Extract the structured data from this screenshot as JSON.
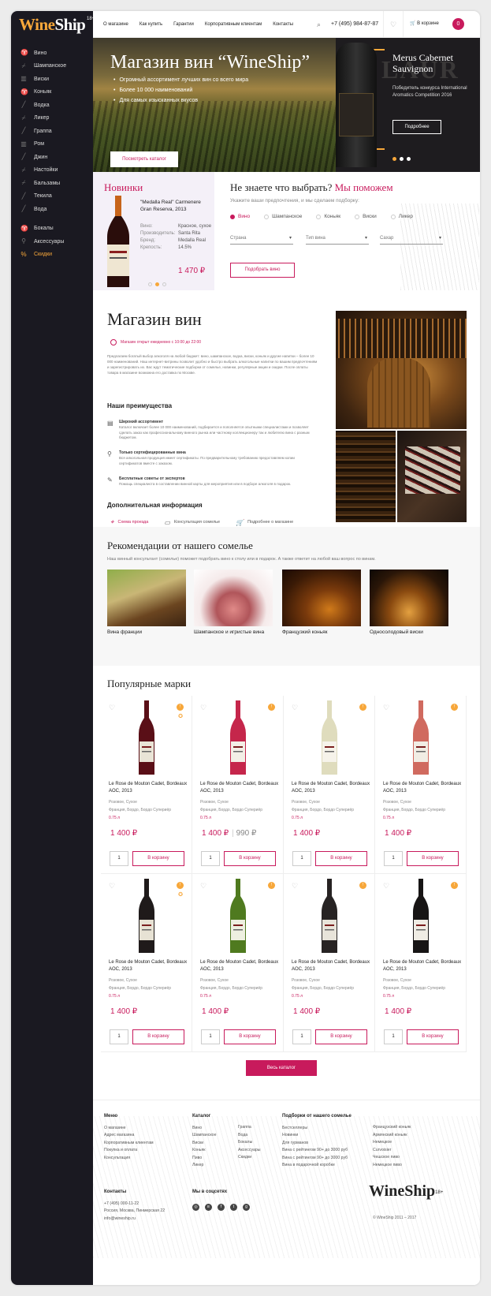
{
  "logo": {
    "part1": "Wine",
    "part2": "Ship",
    "age": "18+"
  },
  "sidebar": {
    "items": [
      {
        "label": "Вино",
        "icon": "wine-glass-icon"
      },
      {
        "label": "Шампанское",
        "icon": "champagne-icon"
      },
      {
        "label": "Виски",
        "icon": "whisky-icon"
      },
      {
        "label": "Коньяк",
        "icon": "cognac-icon"
      },
      {
        "label": "Водка",
        "icon": "vodka-icon"
      },
      {
        "label": "Ликер",
        "icon": "liqueur-icon"
      },
      {
        "label": "Граппа",
        "icon": "grappa-icon"
      },
      {
        "label": "Ром",
        "icon": "rum-icon"
      },
      {
        "label": "Джин",
        "icon": "gin-icon"
      },
      {
        "label": "Настойки",
        "icon": "tincture-icon"
      },
      {
        "label": "Бальзамы",
        "icon": "balsam-icon"
      },
      {
        "label": "Текила",
        "icon": "tequila-icon"
      },
      {
        "label": "Вода",
        "icon": "water-icon"
      }
    ],
    "extra": [
      {
        "label": "Бокалы",
        "icon": "glass-icon"
      },
      {
        "label": "Аксессуары",
        "icon": "accessory-icon"
      },
      {
        "label": "Скидки",
        "icon": "percent-icon"
      }
    ]
  },
  "header": {
    "nav": [
      "О магазине",
      "Как купить",
      "Гарантии",
      "Корпоративным клиентам",
      "Контакты"
    ],
    "phone": "+7 (495) 984-87-87",
    "cart_label": "В корзине",
    "cart_count": "0"
  },
  "hero": {
    "title": "Магазин вин “WineShip”",
    "bullets": [
      "Огромный ассортимент лучших вин со всего мира",
      "Более 10 000 наименований",
      "Для самых изысканных вкусов"
    ],
    "button": "Посмотреть каталог"
  },
  "promo": {
    "glyph": "LAUR",
    "title": "Merus Cabernet Sauvignon",
    "desc": "Победитель конкурса International Aromatics Competition 2016",
    "button": "Подробнее"
  },
  "news": {
    "title": "Новинки",
    "product": "\"Medalla Real\" Carmenere Gran Reserva, 2013",
    "specs": [
      {
        "k": "Вино:",
        "v": "Красное, сухое"
      },
      {
        "k": "Производитель:",
        "v": "Santa Rita"
      },
      {
        "k": "Бренд:",
        "v": "Medalla Real"
      },
      {
        "k": "Крепость:",
        "v": "14.5%"
      }
    ],
    "price": "1 470 ₽"
  },
  "helper": {
    "title": "Не знаете что выбрать?",
    "title_hl": "Мы поможем",
    "sub": "Укажите ваши предпочтения, и мы сделаем подборку:",
    "radios": [
      "Вино",
      "Шампанское",
      "Коньяк",
      "Виски",
      "Ликер"
    ],
    "selects": [
      "Страна",
      "Тип вина",
      "Сахар"
    ],
    "button": "Подобрать вино"
  },
  "store": {
    "title": "Магазин вин",
    "hours": "Магазин открыт ежедневно с 10:00 до 22:00",
    "intro": "Предлагаем богатый выбор алкоголя на любой бюджет: вино, шампанское, водка, виски, коньяк и другие напитки – более 10 000 наименований. Наш интернет-витрины позволит удобно и быстро выбрать алкогольные напитки по вашим предпочтениям и зарегистрировать их. Вас ждут тематические подборки от сомелье, новинки, регулярные акции и скидки. После оплаты товара в магазине возможна его доставка по Москве.",
    "adv_title": "Наши преимущества",
    "adv": [
      {
        "t": "Широкий ассортимент",
        "d": "Каталог включает более 10 000 наименований, подбирается и пополняется опытными специалистами и позволяет сделать заказ как профессиональному винного рынка или частному коллекционеру так и любителю вина с разным бюджетом."
      },
      {
        "t": "Только сертифицированные вина",
        "d": "Вся алкогольная продукция имеет сертификаты. По предварительному требованию предоставляем копии сертификатов вместе с заказом."
      },
      {
        "t": "Бесплатные советы от экспертов",
        "d": "Помощь специалиста в составлении винной карты для мероприятия или в подборе алкоголя в подарок."
      }
    ],
    "info_title": "Дополнительная информация",
    "info": [
      "Схема проезда",
      "Консультация сомелье",
      "Подробнее о магазине"
    ]
  },
  "somm": {
    "title": "Рекомендации от нашего сомелье",
    "desc": "Наш винный консультант (сомелье) поможет подобрать вино к столу или в подарок. А также ответит на любой ваш вопрос по винам.",
    "cards": [
      "Вина франции",
      "Шампанское и игристые вина",
      "Французкий коньяк",
      "Односолодовый виски"
    ]
  },
  "brands": {
    "title": "Популярные марки",
    "products": [
      {
        "name": "Le Rose de Mouton Cadet, Bordeaux AOC, 2013",
        "type": "Розовое, Сухое",
        "region": "Франция, Бордо, Бордо Супериёр",
        "vol": "0.75 л",
        "price": "1 400 ₽",
        "old": "",
        "color": "#5a0f17",
        "label": "#e9e4d6"
      },
      {
        "name": "Le Rose de Mouton Cadet, Bordeaux AOC, 2013",
        "type": "Розовое, Сухое",
        "region": "Франция, Бордо, Бордо Супериёр",
        "vol": "0.75 л",
        "price": "1 400 ₽",
        "old": "990 ₽",
        "color": "#c5264b",
        "label": "#f3efe6"
      },
      {
        "name": "Le Rose de Mouton Cadet, Bordeaux AOC, 2013",
        "type": "Розовое, Сухое",
        "region": "Франция, Бордо, Бордо Супериёр",
        "vol": "0.75 л",
        "price": "1 400 ₽",
        "old": "",
        "color": "#dfdcbd",
        "label": "#f6f3ea"
      },
      {
        "name": "Le Rose de Mouton Cadet, Bordeaux AOC, 2013",
        "type": "Розовое, Сухое",
        "region": "Франция, Бордо, Бордо Супериёр",
        "vol": "0.75 л",
        "price": "1 400 ₽",
        "old": "",
        "color": "#d06a5f",
        "label": "#f1ede4"
      },
      {
        "name": "Le Rose de Mouton Cadet, Bordeaux AOC, 2013",
        "type": "Розовое, Сухое",
        "region": "Франция, Бордо, Бордо Супериёр",
        "vol": "0.75 л",
        "price": "1 400 ₽",
        "old": "",
        "color": "#1f1a1a",
        "label": "#e7e2d4"
      },
      {
        "name": "Le Rose de Mouton Cadet, Bordeaux AOC, 2013",
        "type": "Розовое, Сухое",
        "region": "Франция, Бордо, Бордо Супериёр",
        "vol": "0.75 л",
        "price": "1 400 ₽",
        "old": "",
        "color": "#4f7a1f",
        "label": "#eef0e0"
      },
      {
        "name": "Le Rose de Mouton Cadet, Bordeaux AOC, 2013",
        "type": "Розовое, Сухое",
        "region": "Франция, Бордо, Бордо Супериёр",
        "vol": "0.75 л",
        "price": "1 400 ₽",
        "old": "",
        "color": "#272323",
        "label": "#e8e4da"
      },
      {
        "name": "Le Rose de Mouton Cadet, Bordeaux AOC, 2013",
        "type": "Розовое, Сухое",
        "region": "Франция, Бордо, Бордо Супериёр",
        "vol": "0.75 л",
        "price": "1 400 ₽",
        "old": "",
        "color": "#171515",
        "label": "#efece4"
      }
    ],
    "qty": "1",
    "to_cart": "В корзину",
    "all": "Весь каталог"
  },
  "footer": {
    "menu_title": "Меню",
    "menu": [
      "О магазине",
      "Адрес магазина",
      "Корпоративным клиентам",
      "Покупка и оплата",
      "Консультация"
    ],
    "catalog_title": "Каталог",
    "catalog1": [
      "Вино",
      "Шампанское",
      "Виски",
      "Коньяк",
      "Пиво",
      "Ликер"
    ],
    "catalog2": [
      "Граппа",
      "Вода",
      "Бокалы",
      "Аксессуары",
      "Скидки"
    ],
    "picks_title": "Подборки от нашего сомелье",
    "picks1": [
      "Бестселлеры",
      "Новинки",
      "Для гурманов",
      "Вина с рейтингом 90+ до 3000 руб",
      "Вина с рейтингом 90+ до 3000 руб",
      "Вина в подарочной коробке"
    ],
    "picks2": [
      "Французский коньяк",
      "Армянский коньяк",
      "Немецкое",
      "Curvoisier",
      "Чешское пиво",
      "Немецкое пиво"
    ],
    "contacts_title": "Контакты",
    "contacts": [
      "+7 (495) 000-11-22",
      "Россия, Москва, Пинмерская 22",
      "info@wineship.ru"
    ],
    "social_title": "Мы в соцсетях",
    "social": [
      "instagram-icon",
      "vk-icon",
      "facebook-icon",
      "twitter-icon",
      "google-plus-icon"
    ],
    "copyright": "© WineShip 2011 – 2017"
  },
  "colors": {
    "accent": "#c81a5c",
    "orange": "#f7a73a",
    "sidebar": "#1a1921"
  }
}
